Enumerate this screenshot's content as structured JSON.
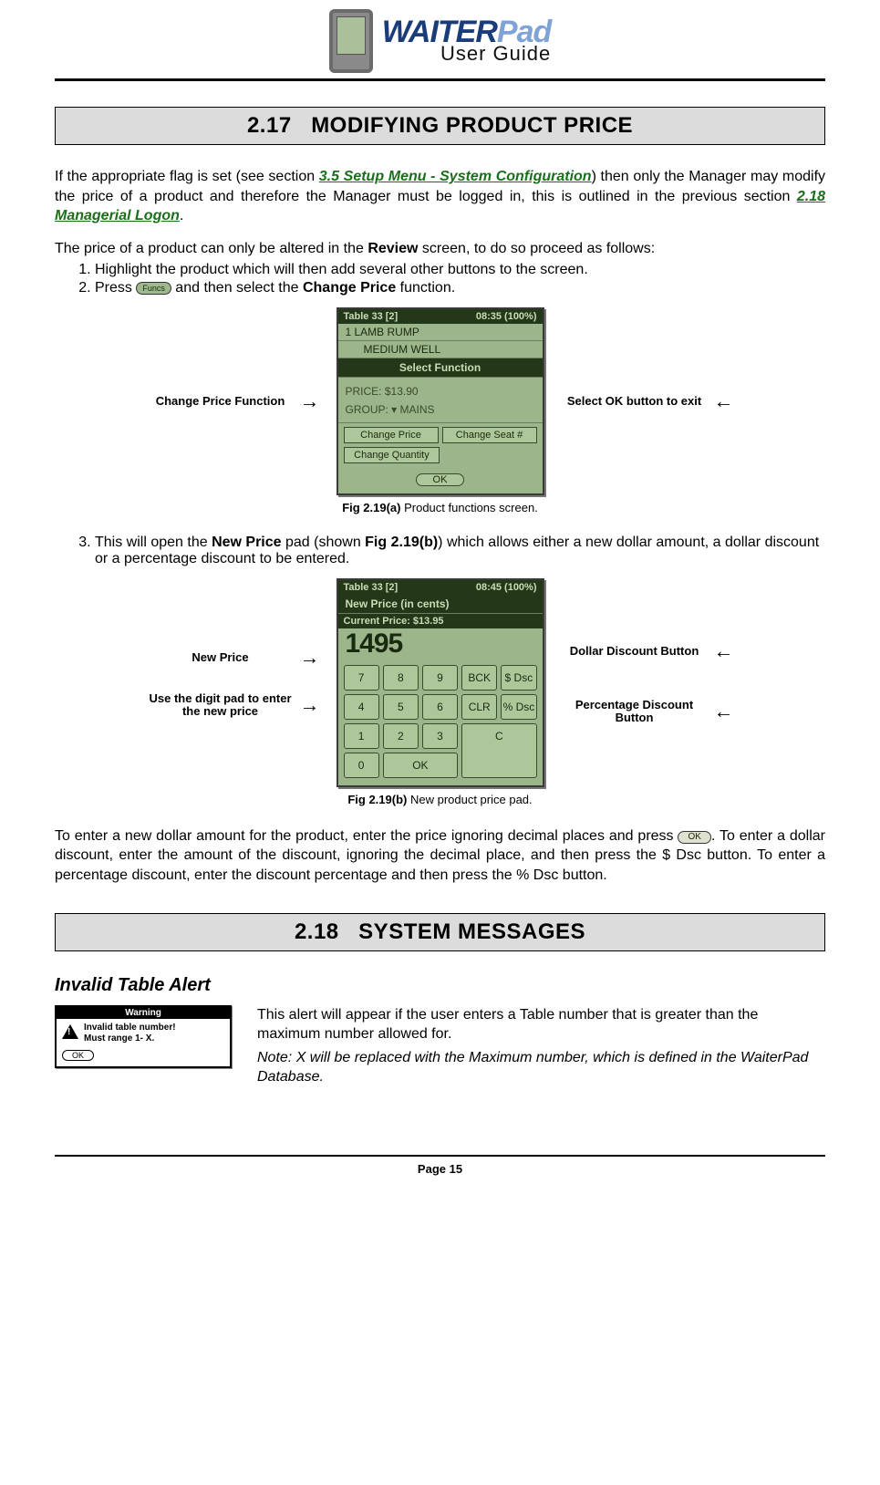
{
  "logo": {
    "main": "WAITER",
    "pad": "Pad",
    "sub": "User Guide"
  },
  "section217": {
    "number": "2.17",
    "title": "MODIFYING PRODUCT PRICE",
    "p1_a": "If the appropriate flag is set (see section ",
    "p1_link1": "3.5 Setup Menu - System Configuration",
    "p1_b": ") then only the Manager may modify the price of a product and therefore the Manager must be logged in, this is outlined in the previous section ",
    "p1_link2": "2.18 Managerial Logon",
    "p1_c": ".",
    "p2_a": "The price of a product can only be altered in the ",
    "p2_bold": "Review",
    "p2_b": " screen, to do so proceed as follows:",
    "step1": "Highlight the product which will then add several other buttons to the screen.",
    "step2_a": "Press ",
    "step2_btn": "Funcs",
    "step2_b": " and then select the ",
    "step2_bold": "Change Price",
    "step2_c": " function.",
    "callout_left_a": "Change Price Function",
    "callout_right_a": "Select OK button to exit",
    "figA_label": "Fig 2.19(a)",
    "figA_caption": " Product functions screen.",
    "step3_a": "This will open the ",
    "step3_bold1": "New Price",
    "step3_b": " pad (shown ",
    "step3_bold2": "Fig 2.19(b)",
    "step3_c": ") which allows either a new dollar amount, a dollar discount or a percentage discount to be entered.",
    "callout2_left_a": "New Price",
    "callout2_left_b": "Use the digit pad to enter the new price",
    "callout2_right_a": "Dollar Discount Button",
    "callout2_right_b": "Percentage Discount Button",
    "figB_label": "Fig 2.19(b)",
    "figB_caption": " New product price pad.",
    "p3_a": "To enter a new dollar amount for the product, enter the price ignoring decimal places and press ",
    "p3_ok": "OK",
    "p3_b": ". To enter a dollar discount, enter the amount of the discount, ignoring the decimal place, and then press the $ Dsc button. To enter a percentage discount, enter the discount percentage and then press the % Dsc button."
  },
  "screenA": {
    "table": "Table 33 [2]",
    "clock": "08:35 (100%)",
    "line1": "1    LAMB RUMP",
    "line2": "MEDIUM WELL",
    "sf": "Select Function",
    "price": "PRICE:    $13.90",
    "group": "GROUP:  ▾ MAINS",
    "b1": "Change Price",
    "b2": "Change Seat #",
    "b3": "Change Quantity",
    "ok": "OK"
  },
  "screenB": {
    "table": "Table 33 [2]",
    "clock": "08:45 (100%)",
    "title": "New Price (in cents)",
    "cur": "Current Price:  $13.95",
    "big": "1495",
    "keys": [
      "7",
      "8",
      "9",
      "BCK",
      "$ Dsc",
      "4",
      "5",
      "6",
      "CLR",
      "% Dsc",
      "1",
      "2",
      "3",
      "0",
      "OK",
      "C"
    ]
  },
  "section218": {
    "number": "2.18",
    "title": "SYSTEM MESSAGES",
    "sub": "Invalid Table Alert",
    "warn_title": "Warning",
    "warn_msg1": "Invalid table number!",
    "warn_msg2": "Must range 1- X.",
    "warn_ok": "OK",
    "body_a": "This alert will appear if the user enters a Table number that is greater than the maximum number allowed for.",
    "body_note": "Note:  X will be replaced with the Maximum number, which is defined in the WaiterPad Database."
  },
  "footer": "Page 15"
}
